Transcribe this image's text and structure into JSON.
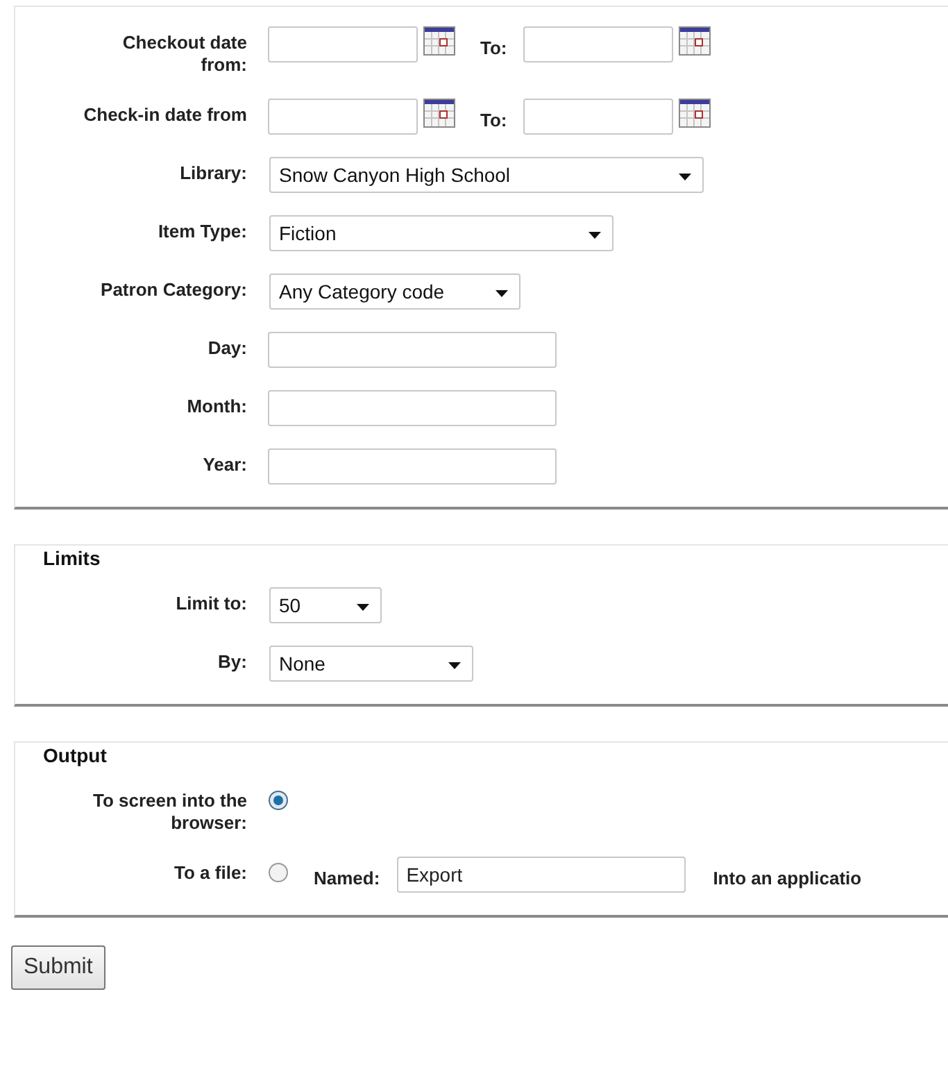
{
  "sections": [
    {
      "rows": [
        {
          "kind": "date_range",
          "label": "Checkout date from:",
          "to_label": "To:"
        },
        {
          "kind": "date_range",
          "label": "Check-in date from",
          "to_label": "To:"
        },
        {
          "kind": "select",
          "label": "Library:",
          "value": "Snow Canyon High School"
        },
        {
          "kind": "select",
          "label": "Item Type:",
          "value": "Fiction"
        },
        {
          "kind": "select",
          "label": "Patron Category:",
          "value": "Any Category code"
        },
        {
          "kind": "text",
          "label": "Day:"
        },
        {
          "kind": "text",
          "label": "Month:"
        },
        {
          "kind": "text",
          "label": "Year:"
        }
      ]
    },
    {
      "legend": "Limits",
      "rows": [
        {
          "kind": "select",
          "label": "Limit to:",
          "value": "50"
        },
        {
          "kind": "select",
          "label": "By:",
          "value": "None"
        }
      ]
    },
    {
      "legend": "Output",
      "rows": [
        {
          "kind": "radio",
          "label": "To screen into the browser:",
          "selected": true
        },
        {
          "kind": "radio_file",
          "label": "To a file:",
          "selected": false,
          "named_label": "Named:",
          "value": "Export",
          "trailing": "Into an applicatio"
        }
      ]
    }
  ],
  "submit": "Submit"
}
